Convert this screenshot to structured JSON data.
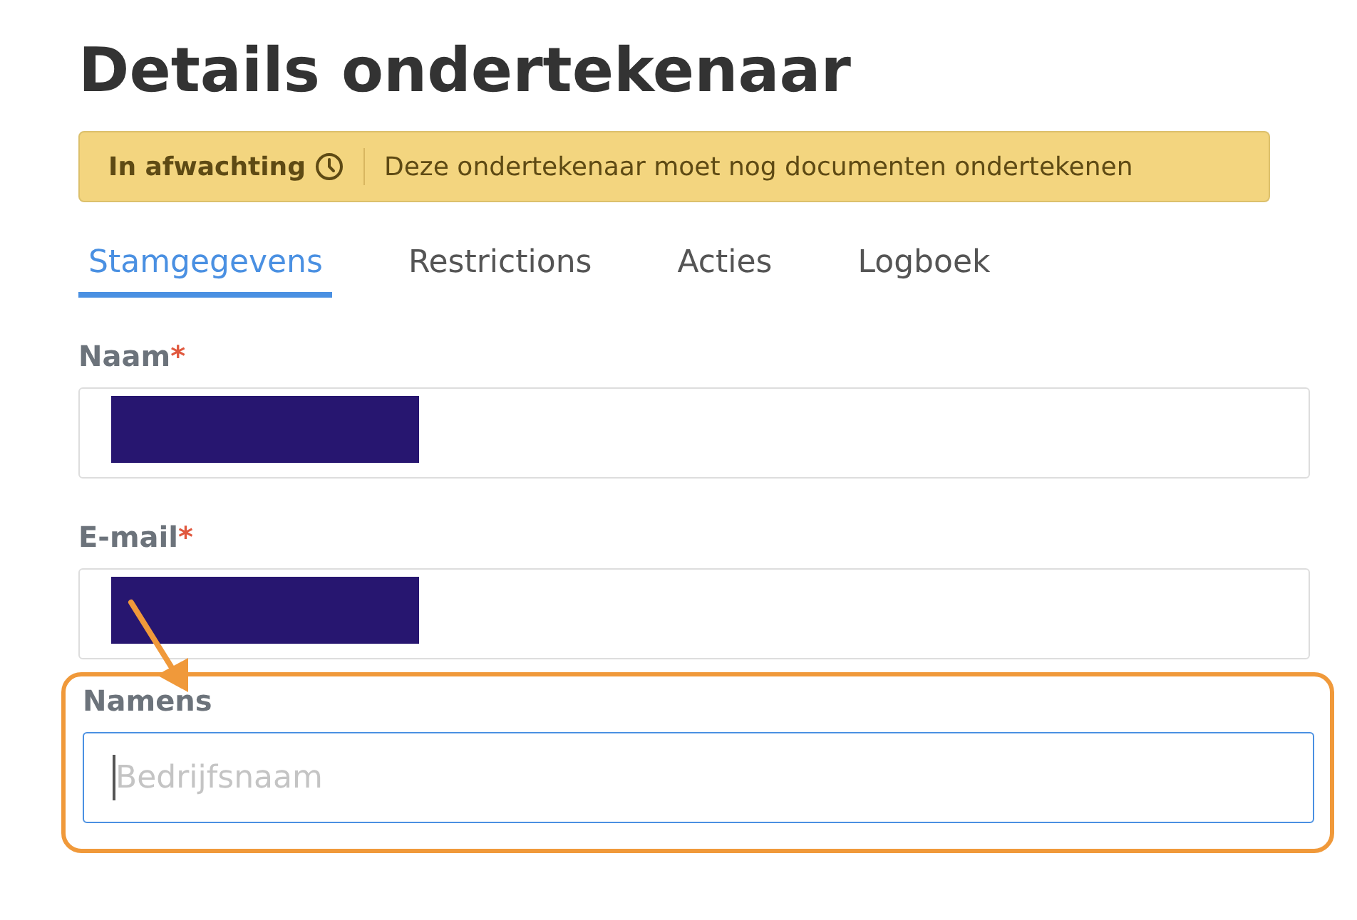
{
  "title": "Details ondertekenaar",
  "status_banner": {
    "status": "In afwachting",
    "message": "Deze ondertekenaar moet nog documenten ondertekenen"
  },
  "tabs": [
    {
      "label": "Stamgegevens",
      "selected": true
    },
    {
      "label": "Restrictions",
      "selected": false
    },
    {
      "label": "Acties",
      "selected": false
    },
    {
      "label": "Logboek",
      "selected": false
    }
  ],
  "fields": [
    {
      "label": "Naam",
      "required_mark": "*",
      "redacted": true,
      "focused": false,
      "highlighted": false
    },
    {
      "label": "E-mail",
      "required_mark": "*",
      "redacted": true,
      "focused": false,
      "highlighted": false
    },
    {
      "label": "Namens",
      "placeholder": "Bedrijfsnaam",
      "redacted": false,
      "focused": true,
      "highlighted": true
    }
  ]
}
